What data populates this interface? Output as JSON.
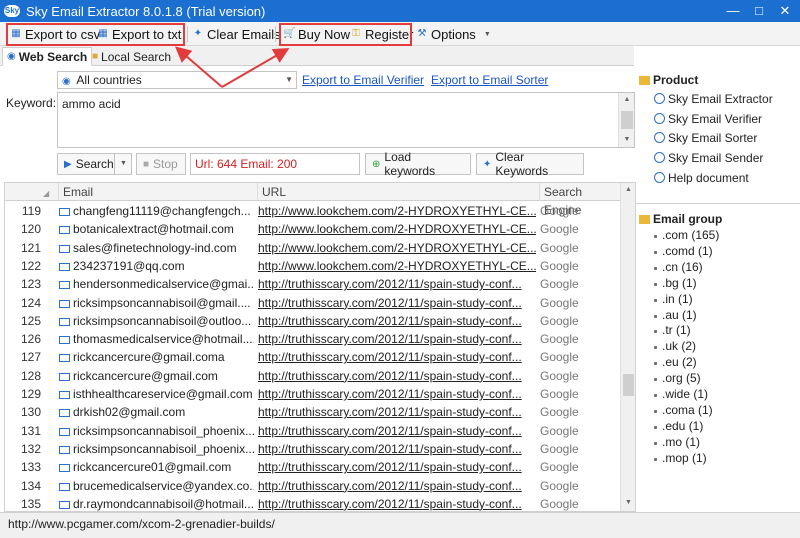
{
  "window": {
    "title": "Sky Email Extractor 8.0.1.8 (Trial version)",
    "app_icon": "Sky"
  },
  "toolbar": {
    "export_csv": "Export to csv",
    "export_txt": "Export to txt",
    "clear_emails": "Clear Emails",
    "buy_now": "Buy Now",
    "register": "Register",
    "options": "Options"
  },
  "tabs": {
    "web_search": "Web Search",
    "local_search": "Local Search"
  },
  "search": {
    "country": "All countries",
    "export_verifier": "Export to Email Verifier",
    "export_sorter": "Export to Email Sorter",
    "keyword_label": "Keyword:",
    "keyword_value": "ammo acid",
    "search_button": "Search",
    "stop_button": "Stop",
    "status": "Url: 644 Email: 200",
    "load_keywords": "Load keywords",
    "clear_keywords": "Clear Keywords"
  },
  "grid": {
    "columns": [
      "Email",
      "URL",
      "Search Engine"
    ],
    "rows": [
      {
        "num": "119",
        "email": "changfeng11119@changfengch...",
        "url": "http://www.lookchem.com/2-HYDROXYETHYL-CE...",
        "engine": "Google"
      },
      {
        "num": "120",
        "email": "botanicalextract@hotmail.com",
        "url": "http://www.lookchem.com/2-HYDROXYETHYL-CE...",
        "engine": "Google"
      },
      {
        "num": "121",
        "email": "sales@finetechnology-ind.com",
        "url": "http://www.lookchem.com/2-HYDROXYETHYL-CE...",
        "engine": "Google"
      },
      {
        "num": "122",
        "email": "234237191@qq.com",
        "url": "http://www.lookchem.com/2-HYDROXYETHYL-CE...",
        "engine": "Google"
      },
      {
        "num": "123",
        "email": "hendersonmedicalservice@gmai...",
        "url": "http://truthisscary.com/2012/11/spain-study-conf...",
        "engine": "Google"
      },
      {
        "num": "124",
        "email": "ricksimpsoncannabisoil@gmail....",
        "url": "http://truthisscary.com/2012/11/spain-study-conf...",
        "engine": "Google"
      },
      {
        "num": "125",
        "email": "ricksimpsoncannabisoil@outloo...",
        "url": "http://truthisscary.com/2012/11/spain-study-conf...",
        "engine": "Google"
      },
      {
        "num": "126",
        "email": "thomasmedicalservice@hotmail....",
        "url": "http://truthisscary.com/2012/11/spain-study-conf...",
        "engine": "Google"
      },
      {
        "num": "127",
        "email": "rickcancercure@gmail.coma",
        "url": "http://truthisscary.com/2012/11/spain-study-conf...",
        "engine": "Google"
      },
      {
        "num": "128",
        "email": "rickcancercure@gmail.com",
        "url": "http://truthisscary.com/2012/11/spain-study-conf...",
        "engine": "Google"
      },
      {
        "num": "129",
        "email": "isthhealthcareservice@gmail.com",
        "url": "http://truthisscary.com/2012/11/spain-study-conf...",
        "engine": "Google"
      },
      {
        "num": "130",
        "email": "drkish02@gmail.com",
        "url": "http://truthisscary.com/2012/11/spain-study-conf...",
        "engine": "Google"
      },
      {
        "num": "131",
        "email": "ricksimpsoncannabisoil_phoenix...",
        "url": "http://truthisscary.com/2012/11/spain-study-conf...",
        "engine": "Google"
      },
      {
        "num": "132",
        "email": "ricksimpsoncannabisoil_phoenix...",
        "url": "http://truthisscary.com/2012/11/spain-study-conf...",
        "engine": "Google"
      },
      {
        "num": "133",
        "email": "rickcancercure01@gmail.com",
        "url": "http://truthisscary.com/2012/11/spain-study-conf...",
        "engine": "Google"
      },
      {
        "num": "134",
        "email": "brucemedicalservice@yandex.co...",
        "url": "http://truthisscary.com/2012/11/spain-study-conf...",
        "engine": "Google"
      },
      {
        "num": "135",
        "email": "dr.raymondcannabisoil@hotmail....",
        "url": "http://truthisscary.com/2012/11/spain-study-conf...",
        "engine": "Google"
      }
    ]
  },
  "product": {
    "heading": "Product",
    "items": [
      "Sky Email Extractor",
      "Sky Email Verifier",
      "Sky Email Sorter",
      "Sky Email Sender",
      "Help document"
    ]
  },
  "email_group": {
    "heading": "Email group",
    "items": [
      ".com (165)",
      ".comd (1)",
      ".cn (16)",
      ".bg (1)",
      ".in (1)",
      ".au (1)",
      ".tr (1)",
      ".uk (2)",
      ".eu (2)",
      ".org (5)",
      ".wide (1)",
      ".coma (1)",
      ".edu (1)",
      ".mo (1)",
      ".mop (1)"
    ]
  },
  "statusbar": {
    "text": "http://www.pcgamer.com/xcom-2-grenadier-builds/"
  },
  "colors": {
    "titlebar": "#1b6fd1",
    "highlight": "#e23b3b",
    "status_red": "#d42020",
    "link": "#1a56c4"
  }
}
